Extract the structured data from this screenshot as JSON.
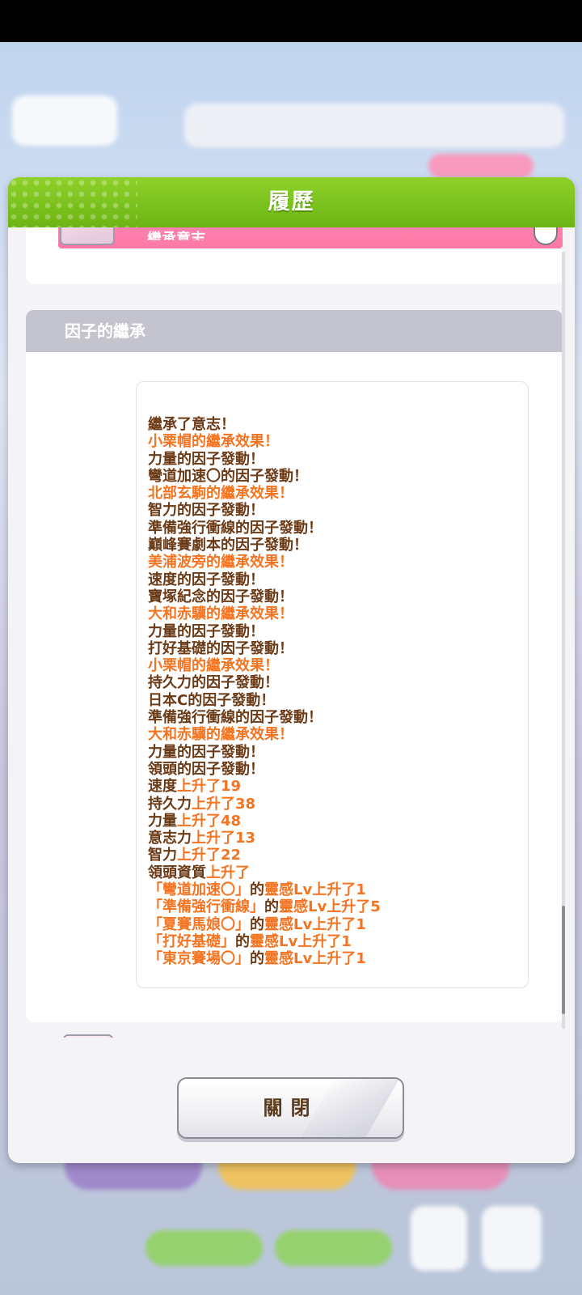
{
  "dialog": {
    "title": "履歷",
    "prev_card_label": "繼承意志",
    "section_title": "因子的繼承",
    "close_label": "關閉"
  },
  "colors": {
    "header_green": "#7cc41c",
    "highlight_orange": "#f47421",
    "text_brown": "#6b3a16",
    "section_gray": "#c4c4cf",
    "card_pink": "#ff7fab"
  },
  "log": [
    {
      "p": "繼承了意志！",
      "h": ""
    },
    {
      "p": "",
      "h": "小栗帽的繼承效果！"
    },
    {
      "p": "力量的因子發動！",
      "h": ""
    },
    {
      "p": "彎道加速〇的因子發動！",
      "h": ""
    },
    {
      "p": "",
      "h": "北部玄駒的繼承效果！"
    },
    {
      "p": "智力的因子發動！",
      "h": ""
    },
    {
      "p": "準備強行衝線的因子發動！",
      "h": ""
    },
    {
      "p": "巔峰賽劇本的因子發動！",
      "h": ""
    },
    {
      "p": "",
      "h": "美浦波旁的繼承效果！"
    },
    {
      "p": "速度的因子發動！",
      "h": ""
    },
    {
      "p": "寶塚紀念的因子發動！",
      "h": ""
    },
    {
      "p": "",
      "h": "大和赤驥的繼承效果！"
    },
    {
      "p": "力量的因子發動！",
      "h": ""
    },
    {
      "p": "打好基礎的因子發動！",
      "h": ""
    },
    {
      "p": "",
      "h": "小栗帽的繼承效果！"
    },
    {
      "p": "持久力的因子發動！",
      "h": ""
    },
    {
      "p": "日本C的因子發動！",
      "h": ""
    },
    {
      "p": "準備強行衝線的因子發動！",
      "h": ""
    },
    {
      "p": "",
      "h": "大和赤驥的繼承效果！"
    },
    {
      "p": "力量的因子發動！",
      "h": ""
    },
    {
      "p": "領頭的因子發動！",
      "h": ""
    },
    {
      "p": "速度",
      "h": "上升了19"
    },
    {
      "p": "持久力",
      "h": "上升了38"
    },
    {
      "p": "力量",
      "h": "上升了48"
    },
    {
      "p": "意志力",
      "h": "上升了13"
    },
    {
      "p": "智力",
      "h": "上升了22"
    },
    {
      "p": "領頭資質",
      "h": "上升了"
    },
    {
      "h1": "「彎道加速〇」",
      "p": "的",
      "h": "靈感Lv上升了1"
    },
    {
      "h1": "「準備強行衝線」",
      "p": "的",
      "h": "靈感Lv上升了5"
    },
    {
      "h1": "「夏賽馬娘〇」",
      "p": "的",
      "h": "靈感Lv上升了1"
    },
    {
      "h1": "「打好基礎」",
      "p": "的",
      "h": "靈感Lv上升了1"
    },
    {
      "h1": "「東京賽場〇」",
      "p": "的",
      "h": "靈感Lv上升了1"
    }
  ]
}
